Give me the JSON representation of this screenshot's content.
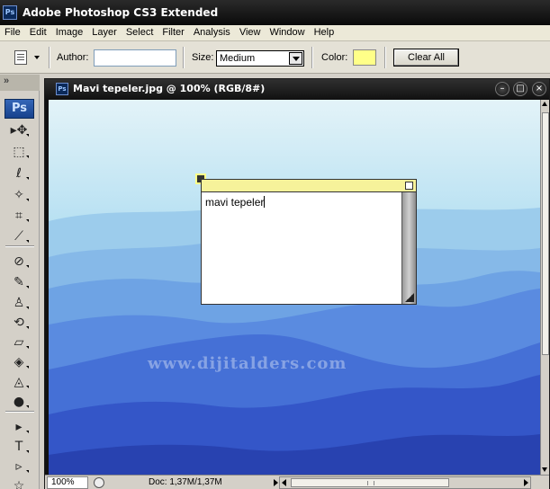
{
  "app": {
    "title": "Adobe Photoshop CS3 Extended",
    "logo_text": "Ps"
  },
  "menu": [
    "File",
    "Edit",
    "Image",
    "Layer",
    "Select",
    "Filter",
    "Analysis",
    "View",
    "Window",
    "Help"
  ],
  "options": {
    "tool_icon": "notes-icon",
    "author_label": "Author:",
    "author_value": "",
    "size_label": "Size:",
    "size_value": "Medium",
    "color_label": "Color:",
    "color_value": "#ffff88",
    "clear_all_label": "Clear All"
  },
  "toolbox": {
    "badge": "Ps",
    "tools": [
      {
        "name": "move-tool-icon",
        "glyph": "▸✥"
      },
      {
        "name": "marquee-tool-icon",
        "glyph": "⬚"
      },
      {
        "name": "lasso-tool-icon",
        "glyph": "ℓ"
      },
      {
        "name": "magic-wand-tool-icon",
        "glyph": "✧"
      },
      {
        "name": "crop-tool-icon",
        "glyph": "⌗"
      },
      {
        "name": "eyedropper-tool-icon",
        "glyph": "⟋"
      },
      {
        "name": "healing-brush-tool-icon",
        "glyph": "⊘"
      },
      {
        "name": "brush-tool-icon",
        "glyph": "✎"
      },
      {
        "name": "clone-stamp-tool-icon",
        "glyph": "♙"
      },
      {
        "name": "history-brush-tool-icon",
        "glyph": "⟲"
      },
      {
        "name": "eraser-tool-icon",
        "glyph": "▱"
      },
      {
        "name": "paint-bucket-tool-icon",
        "glyph": "◈"
      },
      {
        "name": "blur-tool-icon",
        "glyph": "◬"
      },
      {
        "name": "dodge-tool-icon",
        "glyph": "●"
      },
      {
        "name": "path-selection-tool-icon",
        "glyph": "▸"
      },
      {
        "name": "type-tool-icon",
        "glyph": "T"
      },
      {
        "name": "pen-tool-icon",
        "glyph": "▹"
      },
      {
        "name": "shape-tool-icon",
        "glyph": "☆"
      }
    ]
  },
  "document": {
    "title": "Mavi tepeler.jpg @ 100% (RGB/8#)",
    "icon_text": "Ps",
    "watermark": "www.dijitalders.com",
    "note_text": "mavi tepeler",
    "zoom": "100%",
    "doc_info": "Doc: 1,37M/1,37M"
  },
  "colors": {
    "note_header": "#f6f29a",
    "sky_top": "#dff1f7",
    "sky_bottom": "#8ec8e8"
  }
}
